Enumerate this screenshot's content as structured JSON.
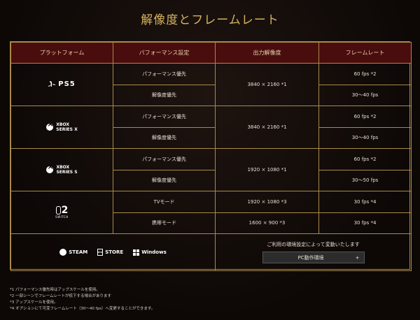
{
  "title": "解像度とフレームレート",
  "headers": [
    "プラットフォーム",
    "パフォーマンス設定",
    "出力解像度",
    "フレームレート"
  ],
  "platforms": [
    {
      "icon": "ps5-logo",
      "name": "PS5",
      "modes": [
        {
          "setting": "パフォーマンス優先",
          "fps": "60 fps *2"
        },
        {
          "setting": "解像度優先",
          "fps": "30〜40 fps"
        }
      ],
      "resolution": "3840 × 2160 *1"
    },
    {
      "icon": "xbox-logo",
      "name_line1": "XBOX",
      "name_line2": "SERIES X",
      "modes": [
        {
          "setting": "パフォーマンス優先",
          "fps": "60 fps *2"
        },
        {
          "setting": "解像度優先",
          "fps": "30〜40 fps"
        }
      ],
      "resolution": "3840 × 2160 *1"
    },
    {
      "icon": "xbox-logo",
      "name_line1": "XBOX",
      "name_line2": "SERIES S",
      "modes": [
        {
          "setting": "パフォーマンス優先",
          "fps": "60 fps *2"
        },
        {
          "setting": "解像度優先",
          "fps": "30〜50 fps"
        }
      ],
      "resolution": "1920 × 1080 *1"
    },
    {
      "icon": "switch2-logo",
      "name_num": "2",
      "name_word": "SWITCH",
      "modes": [
        {
          "setting": "TVモード",
          "resolution": "1920 × 1080 *3",
          "fps": "30 fps *4"
        },
        {
          "setting": "携帯モード",
          "resolution": "1600 × 900 *3",
          "fps": "30 fps *4"
        }
      ]
    }
  ],
  "pc": {
    "stores": [
      "STEAM",
      "STORE",
      "Windows"
    ],
    "env_text": "ご利用の環境設定によって変動いたします",
    "env_button": "PC動作環境",
    "env_button_icon": "+"
  },
  "notes": [
    "*1 パフォーマンス優先時はアップスケールを使用。",
    "*2 一部シーンでフレームレートが低下する場合があります",
    "*3 アップスケールを使用。",
    "*4 オプションにて可変フレームレート（30〜40 fps）へ変更することができます。"
  ]
}
